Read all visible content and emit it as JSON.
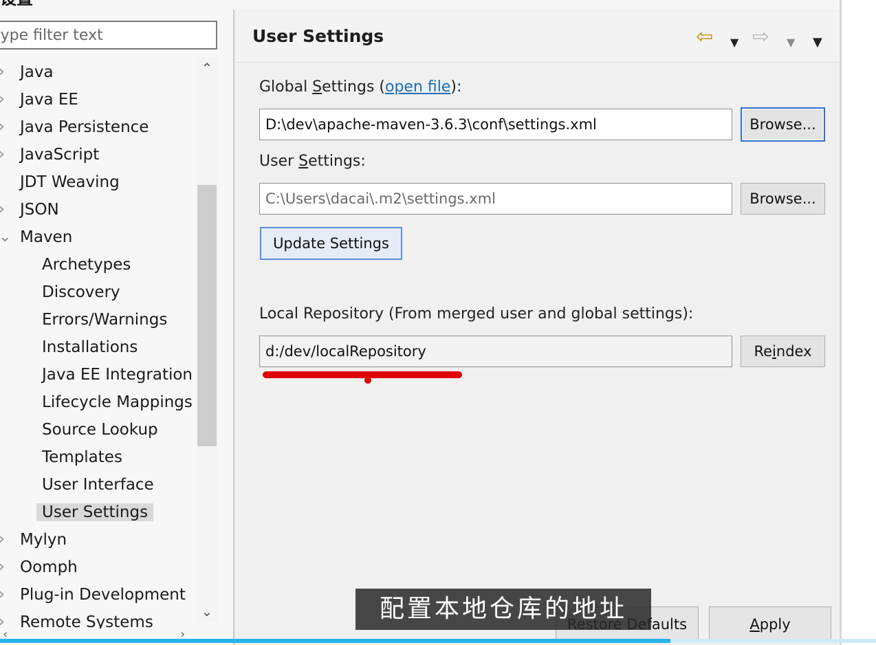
{
  "window": {
    "title_fragment": "设置"
  },
  "filter": {
    "placeholder": "type filter text"
  },
  "tree": {
    "items": [
      {
        "label": "Java",
        "expander": "›"
      },
      {
        "label": "Java EE",
        "expander": "›"
      },
      {
        "label": "Java Persistence",
        "expander": "›"
      },
      {
        "label": "JavaScript",
        "expander": "›"
      },
      {
        "label": "JDT Weaving",
        "expander": ""
      },
      {
        "label": "JSON",
        "expander": "›"
      },
      {
        "label": "Maven",
        "expander": "⌄"
      },
      {
        "label": "Archetypes",
        "expander": ""
      },
      {
        "label": "Discovery",
        "expander": ""
      },
      {
        "label": "Errors/Warnings",
        "expander": ""
      },
      {
        "label": "Installations",
        "expander": ""
      },
      {
        "label": "Java EE Integration",
        "expander": ""
      },
      {
        "label": "Lifecycle Mappings",
        "expander": ""
      },
      {
        "label": "Source Lookup",
        "expander": ""
      },
      {
        "label": "Templates",
        "expander": ""
      },
      {
        "label": "User Interface",
        "expander": ""
      },
      {
        "label": "User Settings",
        "expander": "",
        "selected": true
      },
      {
        "label": "Mylyn",
        "expander": "›"
      },
      {
        "label": "Oomph",
        "expander": "›"
      },
      {
        "label": "Plug-in Development",
        "expander": "›"
      },
      {
        "label": "Remote Systems",
        "expander": "›"
      }
    ]
  },
  "page": {
    "title": "User Settings",
    "nav": {
      "back_icon": "arrow-left-icon",
      "forward_icon": "arrow-right-icon",
      "menu_icon": "chevron-down-icon"
    },
    "global_settings": {
      "label_pre": "Global ",
      "label_u": "S",
      "label_post": "ettings (",
      "link": "open file",
      "label_end": "):",
      "value": "D:\\dev\\apache-maven-3.6.3\\conf\\settings.xml",
      "browse": "Browse..."
    },
    "user_settings": {
      "label_pre": "User ",
      "label_u": "S",
      "label_post": "ettings:",
      "value": "C:\\Users\\dacai\\.m2\\settings.xml",
      "browse": "Browse..."
    },
    "update_button": "Update Settings",
    "local_repo": {
      "label": "Local Repository (From merged user and global settings):",
      "value": "d:/dev/localRepository",
      "reindex_pre": "Re",
      "reindex_u": "i",
      "reindex_post": "ndex"
    }
  },
  "footer": {
    "restore": "Restore Defaults",
    "apply_u": "A",
    "apply_post": "pply"
  },
  "overlay": {
    "subtitle": "配置本地仓库的地址"
  },
  "colors": {
    "link": "#1a6fb5",
    "annotation_red": "#e00000",
    "focus_blue": "#2e6fd1",
    "progress": "#27b3ea"
  }
}
